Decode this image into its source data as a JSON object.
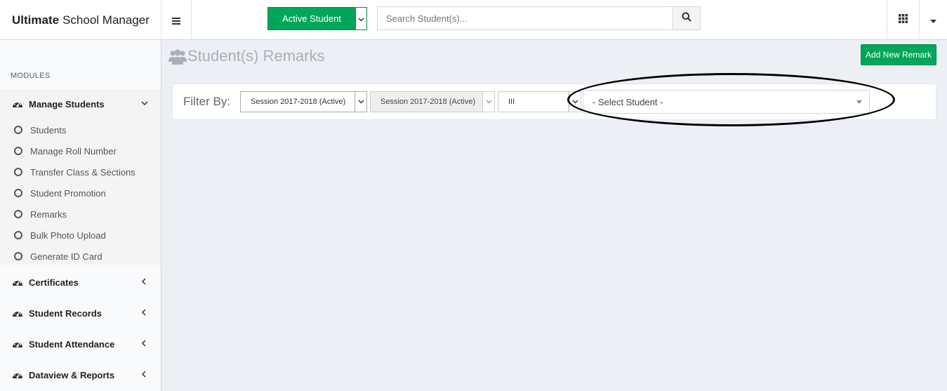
{
  "header": {
    "logo_bold": "Ultimate",
    "logo_rest": "School Manager",
    "active_button_label": "Active Student",
    "search_placeholder": "Search Student(s)..."
  },
  "sidebar": {
    "section_header": "MODULES",
    "manage_students": {
      "label": "Manage Students",
      "sub_items": [
        "Students",
        "Manage Roll Number",
        "Transfer Class & Sections",
        "Student Promotion",
        "Remarks",
        "Bulk Photo Upload",
        "Generate ID Card"
      ]
    },
    "other_items": [
      "Certificates",
      "Student Records",
      "Student Attendance",
      "Dataview & Reports"
    ]
  },
  "main": {
    "page_title": "Student(s) Remarks",
    "add_button_label": "Add New Remark",
    "filter_label": "Filter By:",
    "session_select_value": "Session 2017-2018 (Active)",
    "session_select_disabled_value": "Session 2017-2018 (Active)",
    "class_select_value": "III",
    "student_select_value": "- Select Student -"
  },
  "colors": {
    "accent_green": "#00a65a",
    "background": "#ecf0f5",
    "sidebar_bg": "#f9fafc"
  }
}
